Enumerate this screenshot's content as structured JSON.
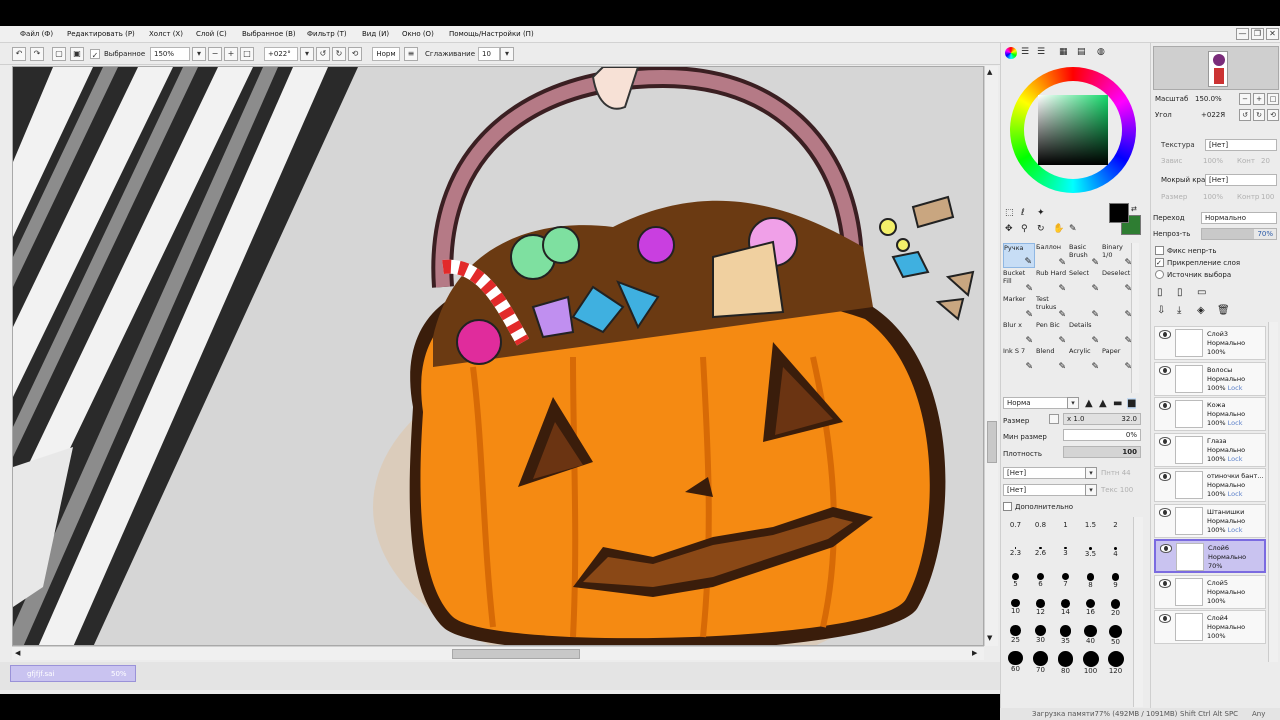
{
  "menu": {
    "items": [
      "Файл (Ф)",
      "Редактировать (Р)",
      "Холст (Х)",
      "Слой (С)",
      "Выбранное (В)",
      "Фильтр (Т)",
      "Вид (И)",
      "Окно (О)",
      "Помощь/Настройки (П)"
    ]
  },
  "window": {
    "minimize": "—",
    "restore": "❐",
    "close": "✕"
  },
  "toolbar": {
    "selection_checkbox_label": "Выбранное",
    "zoom_value": "150%",
    "rotation_value": "+022°",
    "mode_button": "Норм",
    "smoothing_label": "Сглаживание",
    "smoothing_value": "10"
  },
  "document_tab": {
    "filename": "gfjfjf.sai",
    "zoom": "50%"
  },
  "color_panel": {
    "mode_icons": [
      "color-wheel-icon",
      "rgb-sliders-icon",
      "hsv-sliders-icon",
      "swatches-icon",
      "scratchpad-icon",
      "palette-icon"
    ],
    "primary_color": "#000000",
    "secondary_color": "#2e7d32",
    "selected_color": "#5fcc71"
  },
  "navigator": {
    "zoom_label": "Масштаб",
    "zoom_value": "150.0%",
    "angle_label": "Угол",
    "angle_value": "+022Я"
  },
  "texture": {
    "texture_label": "Текстура",
    "texture_value": "[Нет]",
    "scale_label": "Завис",
    "scale_value": "100%",
    "contrast_label": "Конт",
    "contrast_value": "20",
    "edge_label": "Мокрый край",
    "edge_value": "[Нет]",
    "size_label": "Размер",
    "size_value": "100%",
    "contrast2_label": "Контр",
    "contrast2_value": "100"
  },
  "layer_props": {
    "blend_label": "Переход",
    "blend_value": "Нормально",
    "opacity_label": "Непроз-ть",
    "opacity_value": "70%",
    "opacity_fraction": 0.7,
    "protect_alpha": "Фикс непр-ть",
    "clip_layer": "Прикрепление слоя",
    "selection_source": "Источник выбора"
  },
  "tools": [
    {
      "label": "Ручка",
      "active": true
    },
    {
      "label": "Баллон",
      "active": false
    },
    {
      "label": "Basic Brush",
      "active": false
    },
    {
      "label": "Binary 1/0",
      "active": false
    },
    {
      "label": "Bucket Fill",
      "active": false
    },
    {
      "label": "Rub Hard",
      "active": false
    },
    {
      "label": "Select",
      "active": false
    },
    {
      "label": "Deselect",
      "active": false
    },
    {
      "label": "Marker",
      "active": false
    },
    {
      "label": "Test trukus",
      "active": false
    },
    {
      "label": "",
      "active": false
    },
    {
      "label": "",
      "active": false
    },
    {
      "label": "Blur x",
      "active": false
    },
    {
      "label": "Pen Bic",
      "active": false
    },
    {
      "label": "Details",
      "active": false
    },
    {
      "label": "",
      "active": false
    },
    {
      "label": "Ink S 7",
      "active": false
    },
    {
      "label": "Blend",
      "active": false
    },
    {
      "label": "Acrylic",
      "active": false
    },
    {
      "label": "Paper",
      "active": false
    }
  ],
  "brush": {
    "mode_value": "Норма",
    "size_label": "Размер",
    "size_multiplier": "x 1.0",
    "size_value": "32.0",
    "min_size_label": "Мин размер",
    "min_size_value": "0%",
    "density_label": "Плотность",
    "density_value": "100",
    "shape1_value": "[Нет]",
    "shape1_strength": "Пнтн 44",
    "shape2_value": "[Нет]",
    "shape2_strength": "Текс 100",
    "advanced_label": "Дополнительно"
  },
  "brush_sizes": [
    "0.7",
    "0.8",
    "1",
    "1.5",
    "2",
    "2.3",
    "2.6",
    "3",
    "3.5",
    "4",
    "5",
    "6",
    "7",
    "8",
    "9",
    "10",
    "12",
    "14",
    "16",
    "20",
    "25",
    "30",
    "35",
    "40",
    "50",
    "60",
    "70",
    "80",
    "100",
    "120"
  ],
  "layers": [
    {
      "name": "Слой3",
      "mode": "Нормально",
      "opacity": "100%",
      "lock": "",
      "selected": false
    },
    {
      "name": "Волосы",
      "mode": "Нормально",
      "opacity": "100%",
      "lock": "Lock",
      "selected": false
    },
    {
      "name": "Кожа",
      "mode": "Нормально",
      "opacity": "100%",
      "lock": "Lock",
      "selected": false
    },
    {
      "name": "Глаза",
      "mode": "Нормально",
      "opacity": "100%",
      "lock": "Lock",
      "selected": false
    },
    {
      "name": "отиночки бант…",
      "mode": "Нормально",
      "opacity": "100%",
      "lock": "Lock",
      "selected": false
    },
    {
      "name": "Штанишки",
      "mode": "Нормально",
      "opacity": "100%",
      "lock": "Lock",
      "selected": false
    },
    {
      "name": "Слой6",
      "mode": "Нормально",
      "opacity": "70%",
      "lock": "",
      "selected": true
    },
    {
      "name": "Слой5",
      "mode": "Нормально",
      "opacity": "100%",
      "lock": "",
      "selected": false
    },
    {
      "name": "Слой4",
      "mode": "Нормально",
      "opacity": "100%",
      "lock": "",
      "selected": false
    }
  ],
  "status": {
    "memory": "Загрузка памяти77% (492MB / 1091MB)",
    "keys": "Shift Ctrl Alt SPC",
    "any": "Any"
  }
}
